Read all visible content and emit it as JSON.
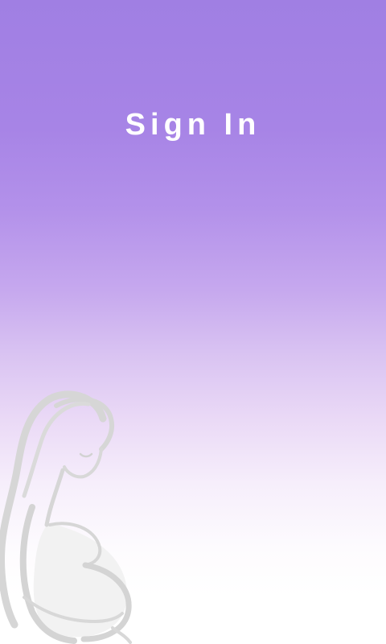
{
  "screen": {
    "title": "Sign In",
    "illustration_icon": "pregnant-woman-silhouette-icon"
  },
  "colors": {
    "gradient_top": "#a07fe3",
    "gradient_bottom": "#ffffff",
    "title_text": "#ffffff",
    "illustration_stroke": "#d6d6d6",
    "illustration_fill": "#f2f2f2"
  }
}
